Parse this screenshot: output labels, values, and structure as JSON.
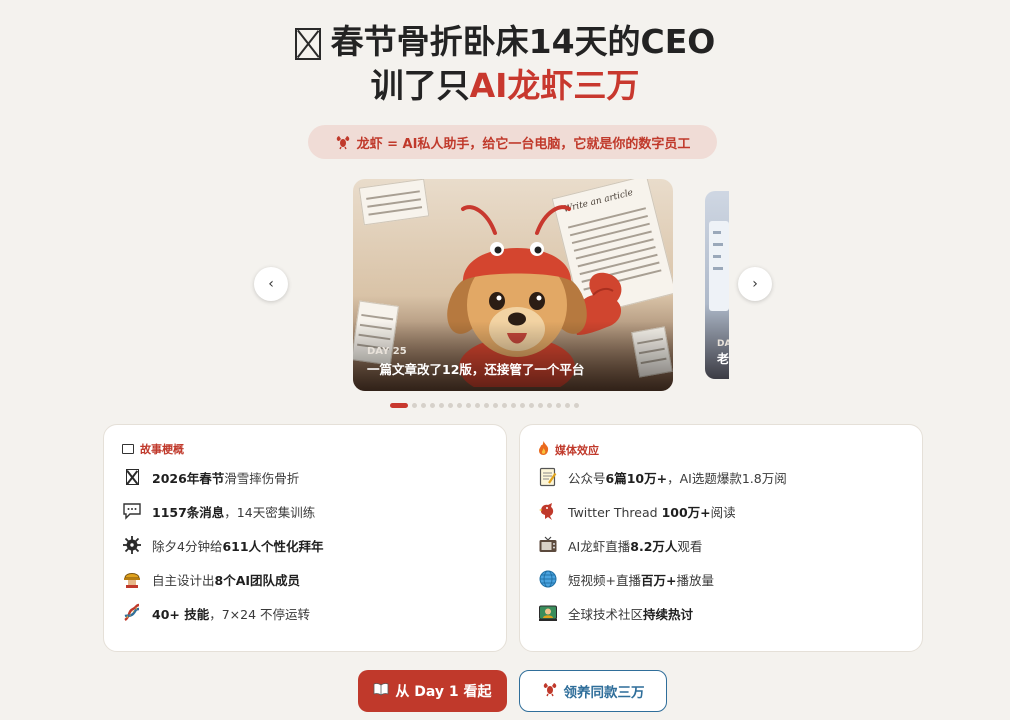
{
  "hero": {
    "line1_text": "春节骨折卧床14天的CEO",
    "line2_prefix": "训了只",
    "line2_accent": "AI龙虾三万"
  },
  "tagline": {
    "icon": "lobster-icon",
    "text": "龙虾 = AI私人助手，给它一台电脑，它就是你的数字员工"
  },
  "carousel": {
    "prev_label": "‹",
    "next_label": "›",
    "current": {
      "day": "DAY 25",
      "caption": "一篇文章改了12版，还接管了一个平台",
      "paper_text": "Write an article"
    },
    "next_peek": {
      "day": "DA",
      "caption": "老"
    },
    "dot_count": 20,
    "active_dot": 0
  },
  "story": {
    "heading": "故事梗概",
    "heading_icon": "book-icon",
    "items": [
      {
        "icon": "broken-glyph-icon",
        "bold": "2026年春节",
        "text": "滑雪摔伤骨折"
      },
      {
        "icon": "speech-bubble-icon",
        "bold": "1157条消息",
        "text": "，14天密集训练"
      },
      {
        "icon": "virus-icon",
        "pre": "除夕4分钟给",
        "bold": "611人个性化拜年"
      },
      {
        "icon": "construction-worker-icon",
        "pre": "自主设计出",
        "bold": "8个AI团队成员"
      },
      {
        "icon": "dna-icon",
        "bold": "40+ 技能",
        "text": "，7×24 不停运转"
      }
    ]
  },
  "media": {
    "heading": "媒体效应",
    "heading_icon": "fire-icon",
    "items": [
      {
        "icon": "memo-icon",
        "pre": "公众号",
        "bold": "6篇10万+",
        "text": "，AI选题爆款1.8万阅"
      },
      {
        "icon": "bird-icon",
        "pre": "Twitter Thread ",
        "bold": "100万+",
        "text": "阅读"
      },
      {
        "icon": "tv-icon",
        "pre": "AI龙虾直播",
        "bold": "8.2万人",
        "text": "观看"
      },
      {
        "icon": "globe-icon",
        "pre": "短视频+直播",
        "bold": "百万+",
        "text": "播放量"
      },
      {
        "icon": "technologist-icon",
        "pre": "全球技术社区",
        "bold": "持续热讨"
      }
    ]
  },
  "actions": {
    "primary_icon": "open-book-icon",
    "primary_label": "从 Day 1 看起",
    "secondary_icon": "lobster-icon",
    "secondary_label": "领养同款三万"
  },
  "colors": {
    "accent": "#c8382e",
    "background": "#f4f2ee",
    "secondary": "#2f6e9a"
  }
}
